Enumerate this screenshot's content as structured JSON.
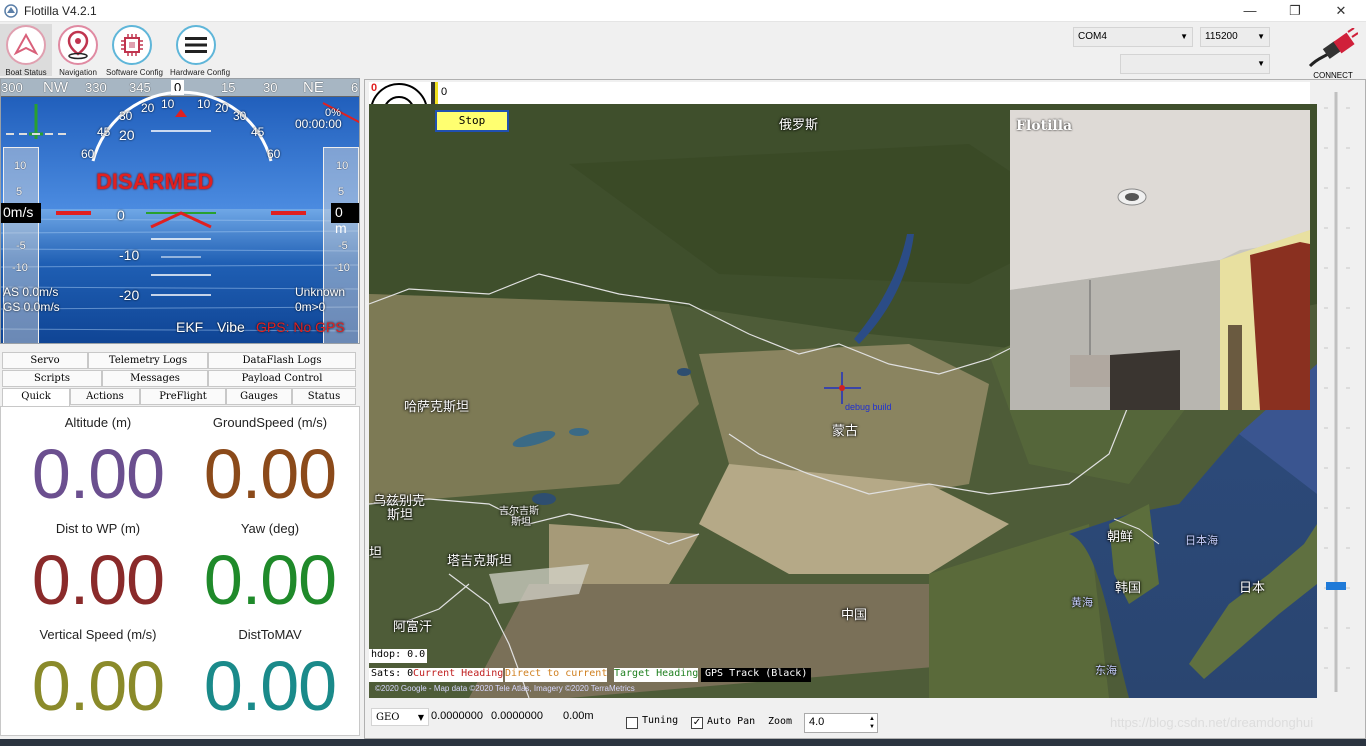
{
  "window": {
    "title": "Flotilla V4.2.1",
    "minimize": "—",
    "maximize": "❐",
    "close": "✕"
  },
  "toolbar": {
    "buttons": [
      {
        "label": "Boat Status"
      },
      {
        "label": "Navigation"
      },
      {
        "label": "Software Config"
      },
      {
        "label": "Hardware Config"
      }
    ],
    "port": "COM4",
    "baud": "115200",
    "connect_label": "CONNECT"
  },
  "hud": {
    "heading_ticks": [
      "300",
      "NW",
      "330",
      "345",
      "0",
      "15",
      "30",
      "NE",
      "6"
    ],
    "status": "DISARMED",
    "time": "00:00:00",
    "alt_percent": "0%",
    "speed_box": "0m/s",
    "alt_box": "0 m",
    "pitch_labels": [
      "20",
      "0",
      "-10",
      "-20"
    ],
    "roll_labels": [
      "60",
      "45",
      "30",
      "20",
      "10",
      "0",
      "10",
      "20",
      "30",
      "45",
      "60"
    ],
    "left_tape": [
      "10",
      "5",
      "-5",
      "-10"
    ],
    "right_tape": [
      "10",
      "5",
      "-5",
      "-10"
    ],
    "airspeed": "AS 0.0m/s",
    "groundspeed": "GS 0.0m/s",
    "mode": "Unknown",
    "wp_dist": "0m>0",
    "ekf": "EKF",
    "vibe": "Vibe",
    "gps": "GPS: No GPS"
  },
  "tabs": {
    "row1": [
      "Servo",
      "Telemetry Logs",
      "DataFlash Logs"
    ],
    "row2": [
      "Scripts",
      "Messages",
      "Payload Control"
    ],
    "row3": [
      "Quick",
      "Actions",
      "PreFlight",
      "Gauges",
      "Status"
    ]
  },
  "quick": [
    {
      "label": "Altitude (m)",
      "value": "0.00",
      "color": "#6b4f8f"
    },
    {
      "label": "GroundSpeed (m/s)",
      "value": "0.00",
      "color": "#8b4a1a"
    },
    {
      "label": "Dist to WP (m)",
      "value": "0.00",
      "color": "#8a2a2a"
    },
    {
      "label": "Yaw (deg)",
      "value": "0.00",
      "color": "#1f8a2a"
    },
    {
      "label": "Vertical Speed (m/s)",
      "value": "0.00",
      "color": "#8a8a2a"
    },
    {
      "label": "DistToMAV",
      "value": "0.00",
      "color": "#1a8a8a"
    }
  ],
  "map": {
    "top_left_value": "0",
    "top_value": "0",
    "stop_label": "Stop",
    "labels": {
      "russia": "俄罗斯",
      "kazakhstan": "哈萨克斯坦",
      "mongolia": "蒙古",
      "uzbekistan_1": "乌兹别克",
      "uzbekistan_2": "斯坦",
      "kyrgyzstan_1": "吉尔吉斯",
      "kyrgyzstan_2": "斯坦",
      "tajikistan": "塔吉克斯坦",
      "afghanistan": "阿富汗",
      "china": "中国",
      "north_korea": "朝鲜",
      "south_korea": "韩国",
      "japan": "日本",
      "sea_of_japan": "日本海",
      "yellow_sea": "黄海",
      "east_sea": "东海",
      "partial": "坦"
    },
    "debug": "debug build",
    "hdop": "hdop: 0.0",
    "sats": "Sats: 0",
    "legend_current": "Current Heading",
    "legend_direct": "Direct to current",
    "legend_target": "Target Heading",
    "legend_gps": "GPS Track (Black)",
    "copyright": "©2020 Google - Map data ©2020 Tele Atlas, Imagery ©2020 TerraMetrics",
    "video_title": "Flotilla"
  },
  "bottom": {
    "geo": "GEO",
    "lat": "0.0000000",
    "lon": "0.0000000",
    "alt": "0.00m",
    "tuning": "Tuning",
    "autopan": "Auto Pan",
    "zoom_label": "Zoom",
    "zoom": "4.0",
    "watermark": "https://blog.csdn.net/dreamdonghui"
  }
}
